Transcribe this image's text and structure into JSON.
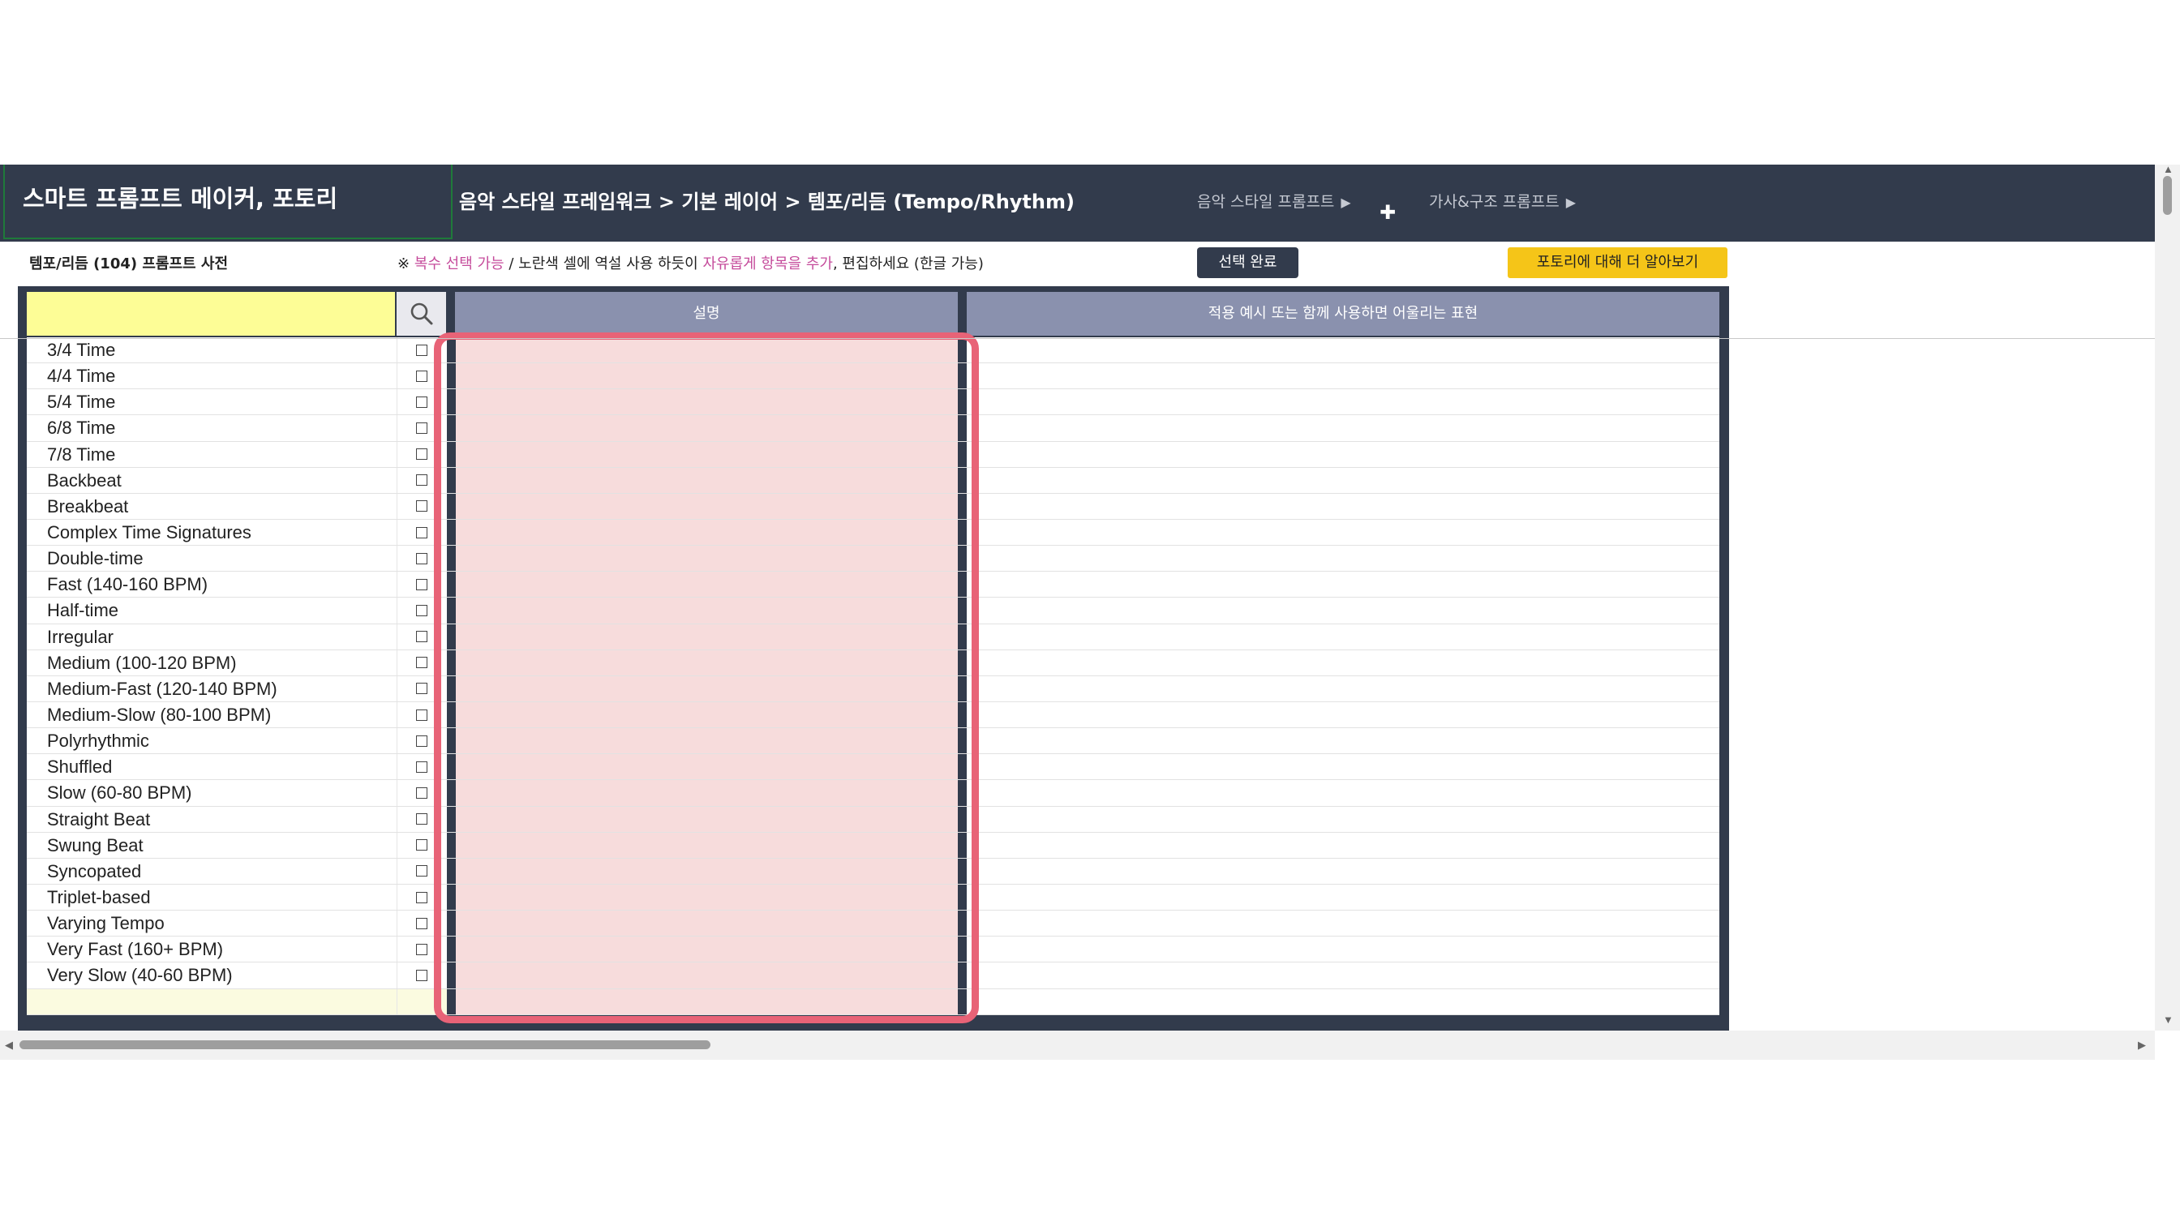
{
  "header": {
    "app_title": "스마트 프롬프트 메이커, 포토리",
    "breadcrumb": "음악 스타일 프레임워크 > 기본 레이어 > 템포/리듬 (Tempo/Rhythm)",
    "nav_music_style": "음악 스타일 프롬프트",
    "nav_lyrics": "가사&구조 프롬프트"
  },
  "subbar": {
    "dictionary_title": "템포/리듬 (104) 프롬프트 사전",
    "notice_prefix": "※ ",
    "notice_multi": "복수 선택 가능",
    "notice_mid": " / 노란색 셀에 역설 사용 하듯이 ",
    "notice_free_add": "자유롭게 항목을 추가",
    "notice_suffix": ", 편집하세요 (한글 가능)",
    "done_button": "선택 완료",
    "learn_more_button": "포토리에 대해 더 알아보기"
  },
  "table": {
    "search_value": "",
    "col_description": "설명",
    "col_examples": "적용 예시 또는 함께 사용하면 어울리는 표현",
    "items": [
      "3/4 Time",
      "4/4 Time",
      "5/4 Time",
      "6/8 Time",
      "7/8 Time",
      "Backbeat",
      "Breakbeat",
      "Complex Time Signatures",
      "Double-time",
      "Fast (140-160 BPM)",
      "Half-time",
      "Irregular",
      "Medium (100-120 BPM)",
      "Medium-Fast (120-140 BPM)",
      "Medium-Slow (80-100 BPM)",
      "Polyrhythmic",
      "Shuffled",
      "Slow (60-80 BPM)",
      "Straight Beat",
      "Swung Beat",
      "Syncopated",
      "Triplet-based",
      "Varying Tempo",
      "Very Fast (160+ BPM)",
      "Very Slow (40-60 BPM)"
    ]
  },
  "colors": {
    "header_bg": "#323b4c",
    "column_header_bg": "#8a91ae",
    "input_yellow": "#fdfd96",
    "highlight_border": "#e86377",
    "desc_fill": "#f7dcdc",
    "learn_more_bg": "#f5c518"
  }
}
